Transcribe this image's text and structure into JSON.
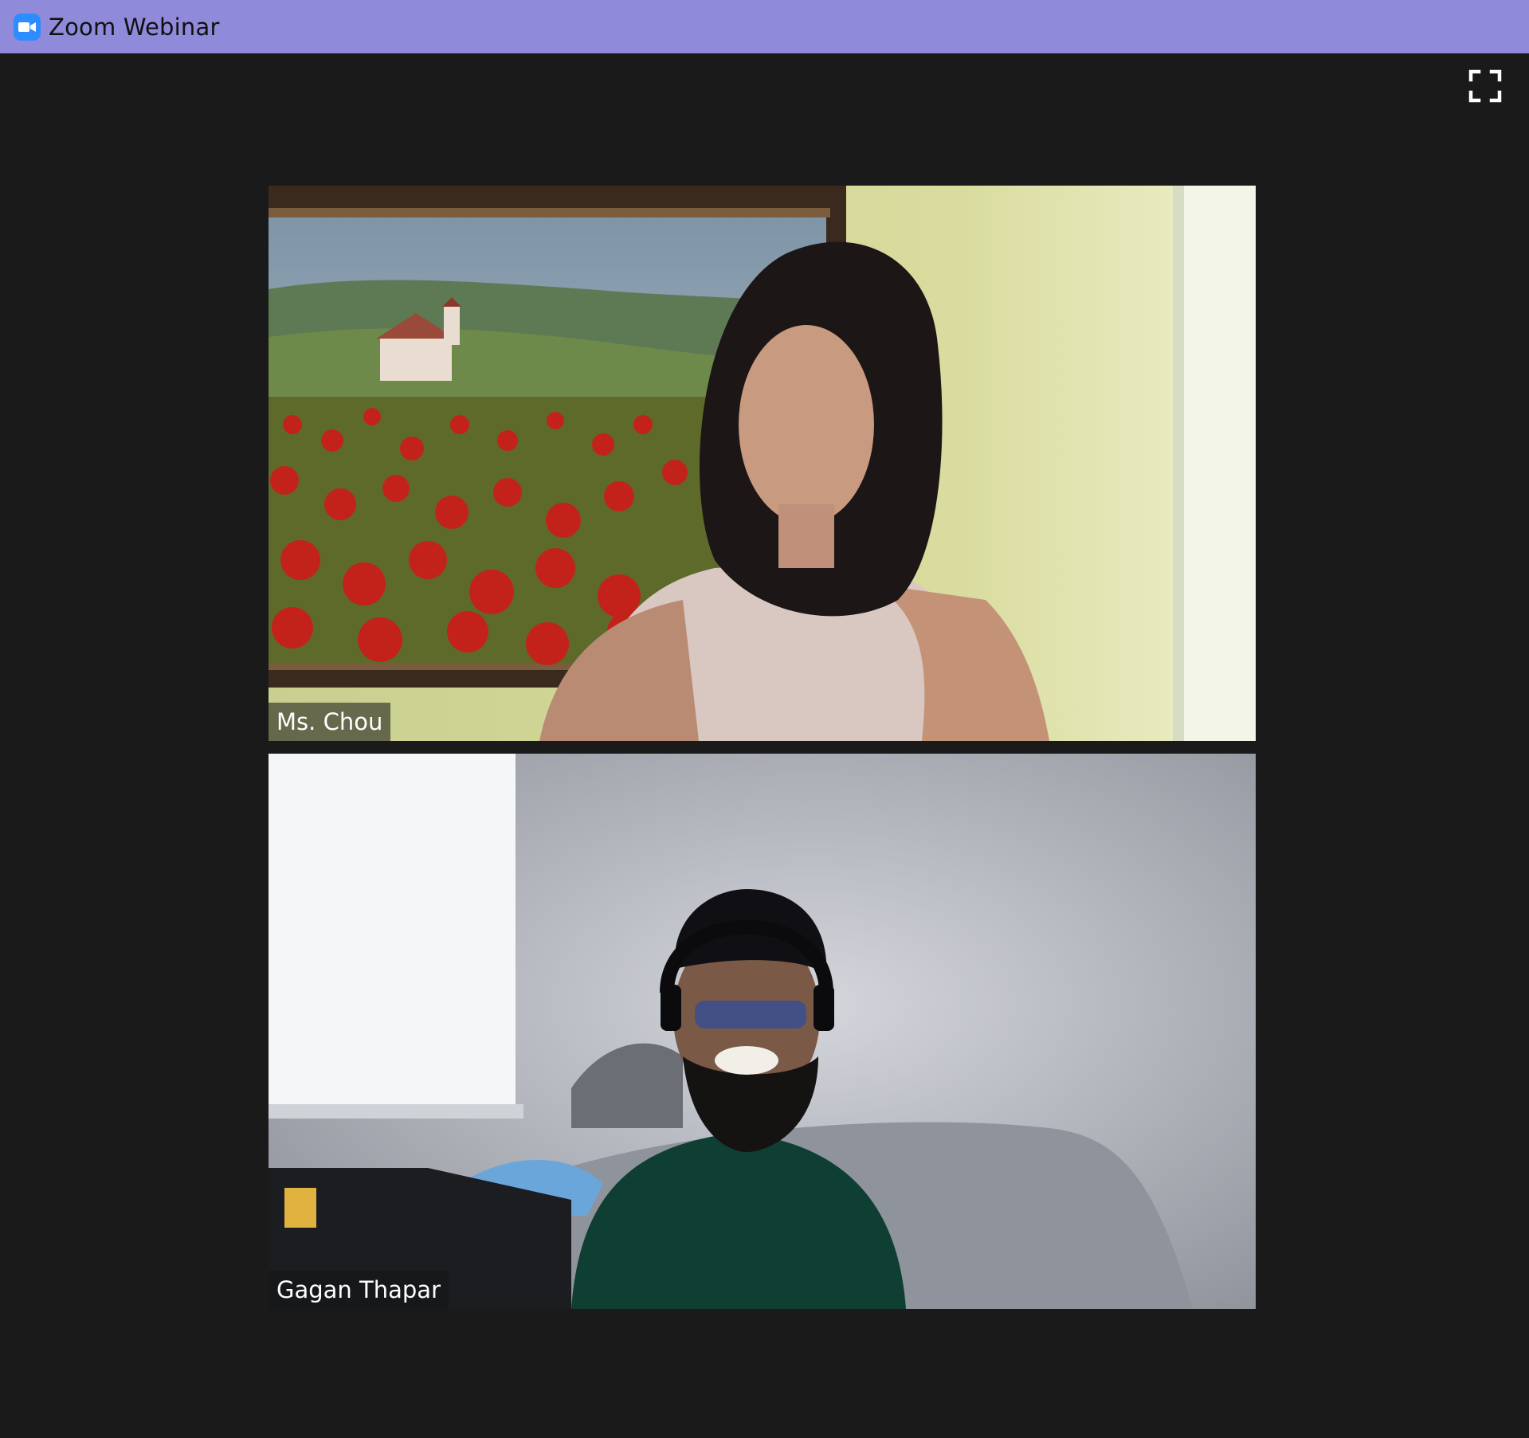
{
  "window": {
    "title": "Zoom Webinar",
    "app_icon": "zoom-camera-icon",
    "titlebar_color": "#8f8ad9",
    "background_color": "#1a1a1a"
  },
  "toolbar": {
    "fullscreen_icon": "fullscreen-icon"
  },
  "participants": [
    {
      "name": "Ms. Chou"
    },
    {
      "name": "Gagan Thapar"
    }
  ]
}
